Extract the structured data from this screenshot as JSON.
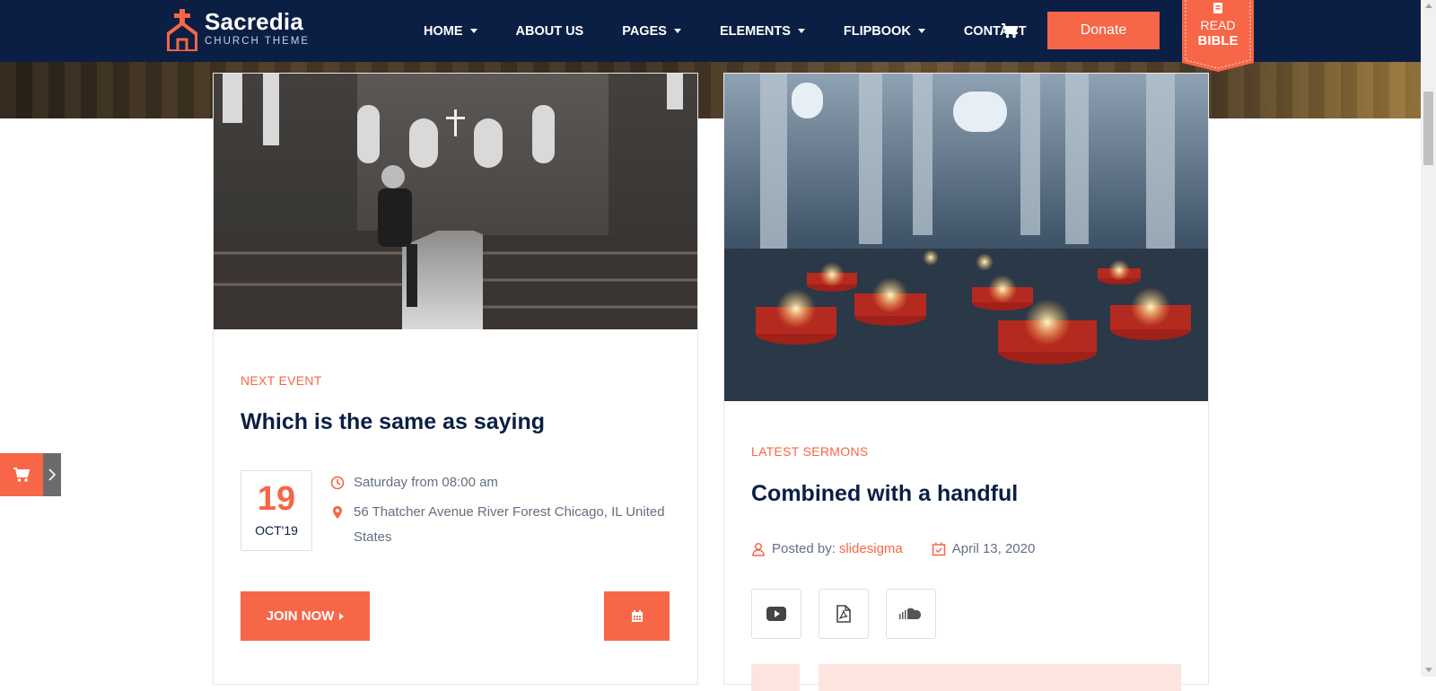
{
  "brand": {
    "name": "Sacredia",
    "tagline": "CHURCH THEME"
  },
  "nav": {
    "items": [
      {
        "label": "HOME",
        "has_dropdown": true
      },
      {
        "label": "ABOUT US",
        "has_dropdown": false
      },
      {
        "label": "PAGES",
        "has_dropdown": true
      },
      {
        "label": "ELEMENTS",
        "has_dropdown": true
      },
      {
        "label": "FLIPBOOK",
        "has_dropdown": true
      },
      {
        "label": "CONTACT",
        "has_dropdown": false
      }
    ],
    "cart_icon": "shopping-cart-icon",
    "donate_label": "Donate",
    "bible": {
      "line1": "READ",
      "line2": "BIBLE",
      "icon": "book-icon"
    }
  },
  "event_card": {
    "label": "NEXT EVENT",
    "title": "Which is the same as saying",
    "date_day": "19",
    "date_month": "OCT'19",
    "time": "Saturday from 08:00 am",
    "address": "56 Thatcher Avenue River Forest Chicago, IL United States",
    "join_label": "JOIN NOW",
    "calendar_icon": "calendar-icon"
  },
  "sermon_card": {
    "label": "LATEST SERMONS",
    "title": "Combined with a handful",
    "posted_by_label": "Posted by:",
    "author": "slidesigma",
    "date": "April 13, 2020",
    "media_icons": [
      "youtube-icon",
      "pdf-file-icon",
      "soundcloud-icon"
    ]
  },
  "colors": {
    "navy": "#0b1f45",
    "accent": "#f76646",
    "text": "#646f80"
  },
  "side_widget": {
    "icon": "shopping-cart-icon",
    "toggle_icon": "chevron-right-icon"
  }
}
